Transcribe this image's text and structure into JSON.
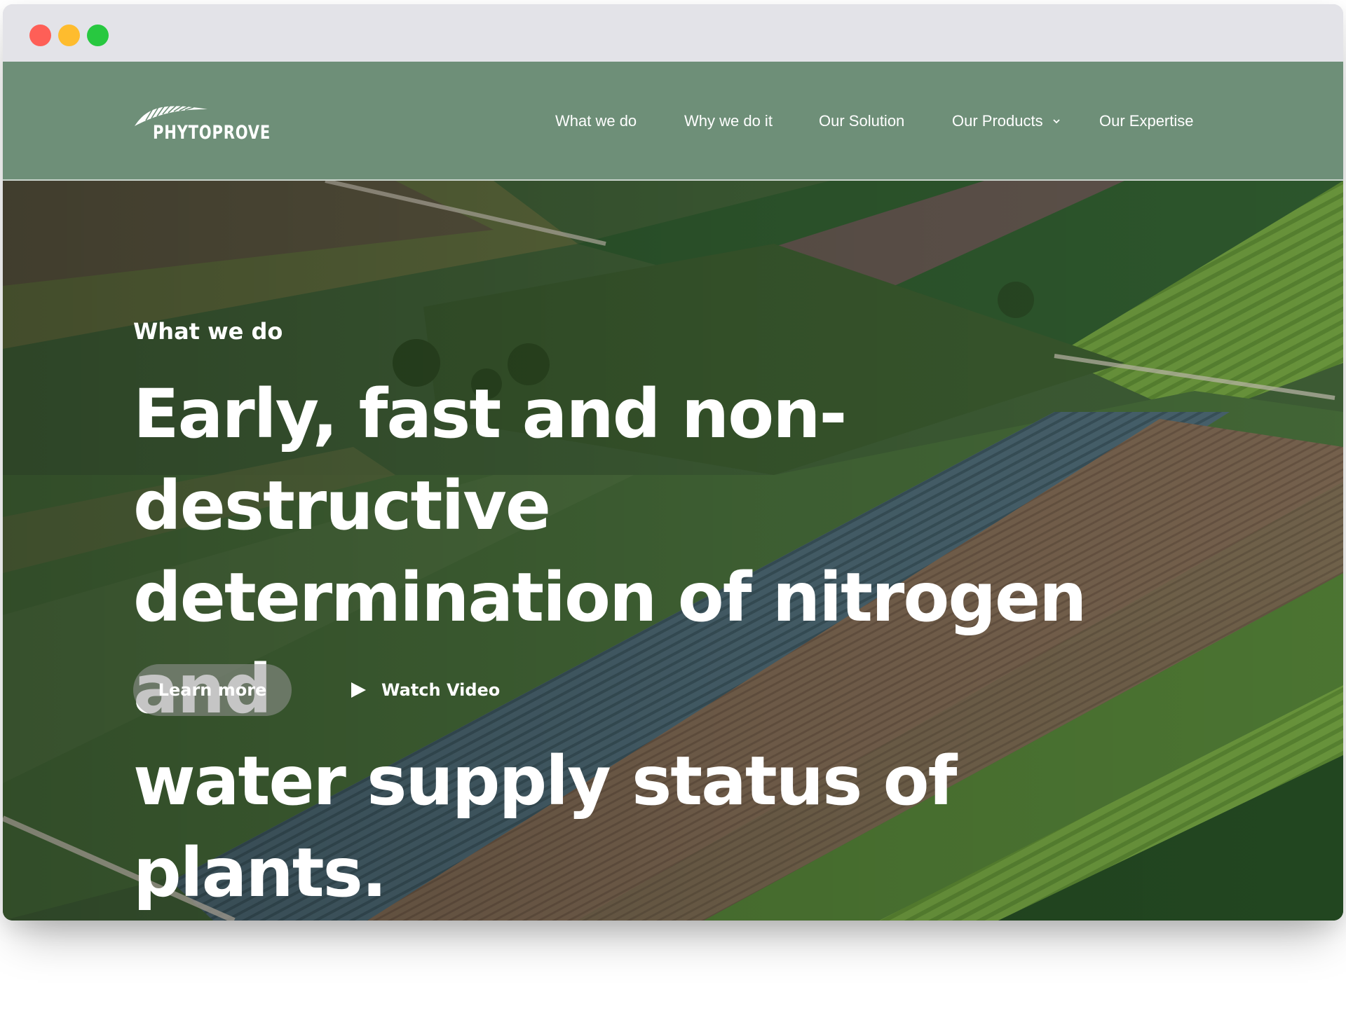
{
  "colors": {
    "navbar_bg": "#6e8f78",
    "titlebar_bg": "#e3e3e8",
    "text": "#ffffff",
    "button_bg": "rgba(150,150,150,0.55)"
  },
  "window": {
    "controls": [
      "close",
      "minimize",
      "maximize"
    ]
  },
  "brand": {
    "name": "PHYTOPROVE",
    "logo_icon": "leaf-lines-icon"
  },
  "nav": {
    "items": [
      {
        "label": "What we do"
      },
      {
        "label": "Why we do it"
      },
      {
        "label": "Our Solution"
      },
      {
        "label": "Our Products",
        "icon": "chevron-down-icon"
      },
      {
        "label": "Our Expertise"
      }
    ]
  },
  "hero": {
    "eyebrow": "What we do",
    "headline_lines": [
      "Early, fast and non-destructive",
      "determination of nitrogen and",
      "water supply status of plants."
    ],
    "learn_more_label": "Learn more",
    "watch_video_label": "Watch Video",
    "watch_video_icon": "play-icon",
    "background": "aerial-farm-fields-image"
  }
}
